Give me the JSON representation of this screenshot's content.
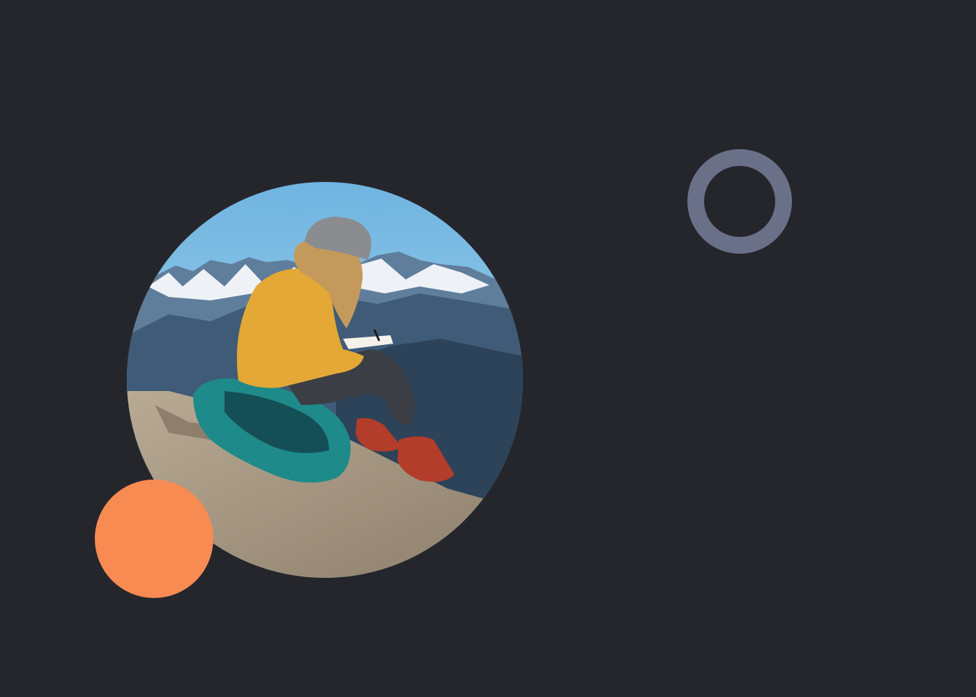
{
  "colors": {
    "background": "#25262c",
    "ring": "#6b7089",
    "dot": "#f78b52",
    "sky_top": "#6fb4e0",
    "sky_bottom": "#b8def2",
    "snow": "#eef2f6",
    "mountain_far": "#5f7e9c",
    "mountain_mid": "#3f5b78",
    "mountain_near": "#2c4359",
    "rock": "#b9aa94",
    "rock_shadow": "#8d7f6c",
    "sweater": "#e3a836",
    "pants": "#3b3e45",
    "beanie": "#8a8c90",
    "hair": "#c49a5c",
    "backpack": "#1f8a8a",
    "backpack_dark": "#134f55",
    "boots": "#b23d2a"
  },
  "scene": {
    "photo_subject": "hiker-writing-in-notebook",
    "icons": [
      "ring-outline-icon",
      "orange-dot-icon"
    ]
  }
}
